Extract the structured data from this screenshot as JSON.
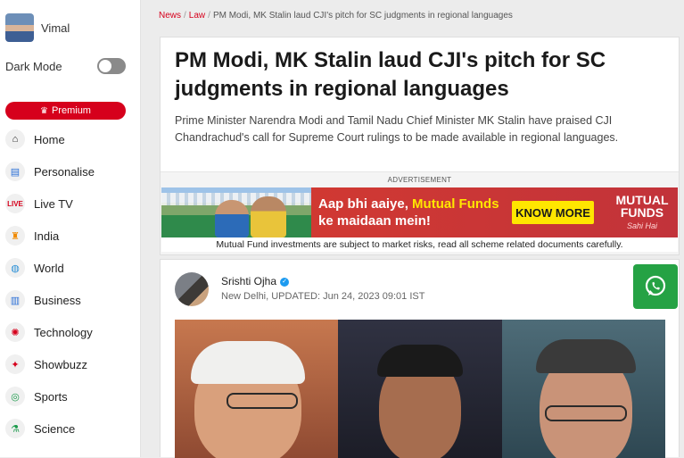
{
  "profile": {
    "name": "Vimal"
  },
  "dark_mode": {
    "label": "Dark Mode"
  },
  "premium": {
    "label": "Premium"
  },
  "menu": [
    {
      "label": "Home",
      "icon": "home-icon"
    },
    {
      "label": "Personalise",
      "icon": "personalise-icon"
    },
    {
      "label": "Live TV",
      "icon": "live-tv-icon"
    },
    {
      "label": "India",
      "icon": "india-icon"
    },
    {
      "label": "World",
      "icon": "world-icon"
    },
    {
      "label": "Business",
      "icon": "business-icon"
    },
    {
      "label": "Technology",
      "icon": "technology-icon"
    },
    {
      "label": "Showbuzz",
      "icon": "showbuzz-icon"
    },
    {
      "label": "Sports",
      "icon": "sports-icon"
    },
    {
      "label": "Science",
      "icon": "science-icon"
    }
  ],
  "breadcrumb": {
    "items": [
      "News",
      "Law"
    ],
    "current": "PM Modi, MK Stalin laud CJI's pitch for SC judgments in regional languages"
  },
  "article": {
    "headline": "PM Modi, MK Stalin laud CJI's pitch for SC judgments in regional languages",
    "summary": "Prime Minister Narendra Modi and Tamil Nadu Chief Minister MK Stalin have praised CJI Chandrachud's call for Supreme Court rulings to be made available in regional languages."
  },
  "ad": {
    "label": "ADVERTISEMENT",
    "line1_lead": "Aap bhi aaiye, ",
    "line1_highlight": "Mutual Funds",
    "line2": "ke maidaan mein!",
    "cta": "KNOW MORE",
    "brand_line1": "MUTUAL",
    "brand_line2": "FUNDS",
    "brand_tag": "Sahi Hai",
    "disclaimer": "Mutual Fund investments are subject to market risks, read all scheme related documents carefully."
  },
  "author": {
    "name": "Srishti Ojha",
    "meta": "New Delhi, UPDATED: Jun 24, 2023 09:01 IST"
  },
  "colors": {
    "accent": "#d6001c",
    "whatsapp": "#25a244"
  }
}
